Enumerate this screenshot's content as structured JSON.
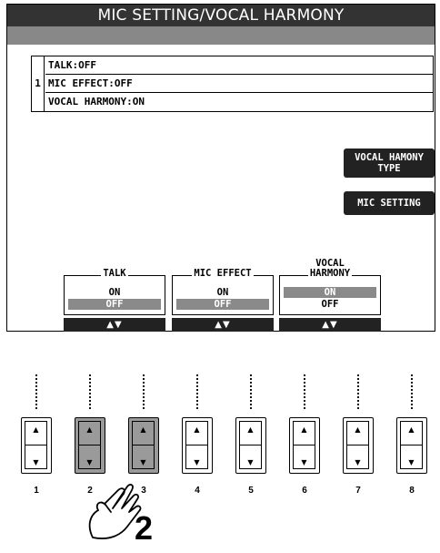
{
  "screen": {
    "title": "MIC SETTING/VOCAL HARMONY",
    "status": {
      "index": "1",
      "rows": [
        "TALK:OFF",
        "MIC EFFECT:OFF",
        "VOCAL HARMONY:ON"
      ]
    },
    "side_buttons": {
      "vocal_harmony_type_line1": "VOCAL HAMONY",
      "vocal_harmony_type_line2": "TYPE",
      "mic_setting": "MIC SETTING"
    },
    "panels": [
      {
        "caption": "TALK",
        "option_on": "ON",
        "option_off": "OFF",
        "selected": "OFF",
        "arrows": "▲▼"
      },
      {
        "caption": "MIC EFFECT",
        "option_on": "ON",
        "option_off": "OFF",
        "selected": "OFF",
        "arrows": "▲▼"
      },
      {
        "caption_line1": "VOCAL",
        "caption_line2": "HARMONY",
        "option_on": "ON",
        "option_off": "OFF",
        "selected": "ON",
        "arrows": "▲▼"
      }
    ]
  },
  "hardware_buttons": {
    "numbers": [
      "1",
      "2",
      "3",
      "4",
      "5",
      "6",
      "7",
      "8"
    ],
    "up_glyph": "▲",
    "down_glyph": "▼",
    "pressed": [
      "2",
      "3"
    ]
  },
  "step": "2",
  "colors": {
    "title_bar": "#333333",
    "selected_option": "#8a8a8a",
    "pressed_button": "#9a9a9a"
  }
}
